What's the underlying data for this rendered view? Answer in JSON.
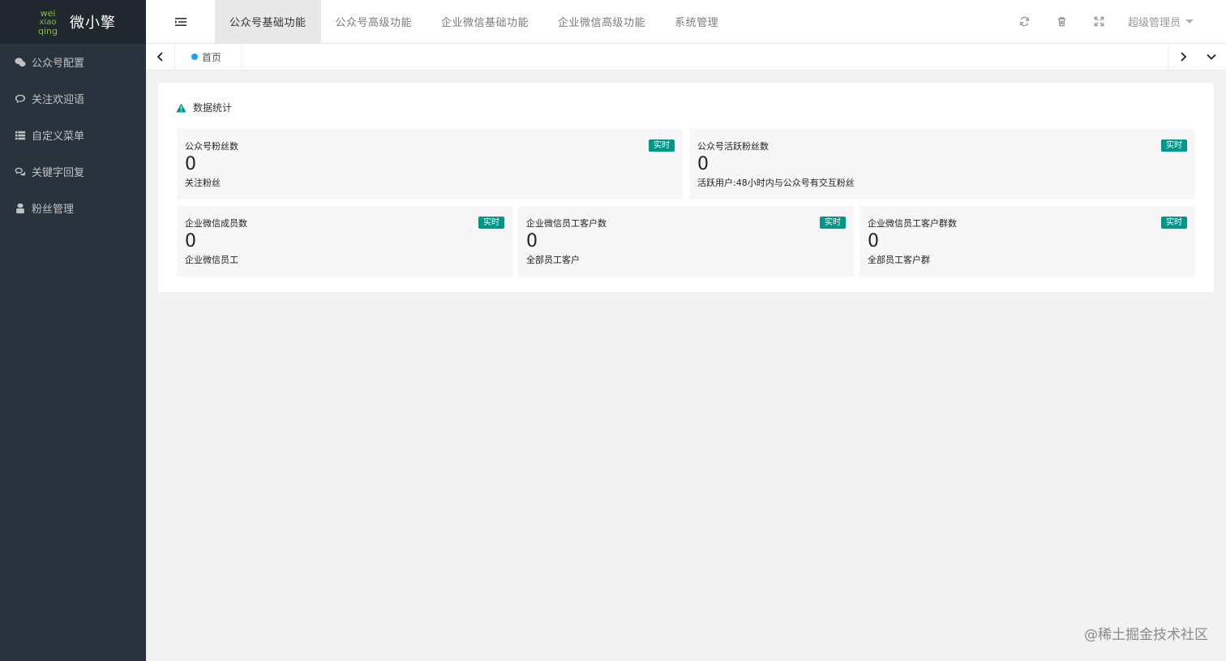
{
  "brand": {
    "logo_lines": [
      "wei",
      "xiao",
      "qing"
    ],
    "title": "微小擎",
    "logo_color": "#7fc241"
  },
  "sidebar": {
    "items": [
      {
        "label": "公众号配置",
        "icon": "wechat-icon"
      },
      {
        "label": "关注欢迎语",
        "icon": "comment-icon"
      },
      {
        "label": "自定义菜单",
        "icon": "list-icon"
      },
      {
        "label": "关键字回复",
        "icon": "chat-bubbles-icon"
      },
      {
        "label": "粉丝管理",
        "icon": "user-icon"
      }
    ]
  },
  "header": {
    "tabs": [
      {
        "label": "公众号基础功能",
        "active": true
      },
      {
        "label": "公众号高级功能",
        "active": false
      },
      {
        "label": "企业微信基础功能",
        "active": false
      },
      {
        "label": "企业微信高级功能",
        "active": false
      },
      {
        "label": "系统管理",
        "active": false
      }
    ],
    "user": "超级管理员"
  },
  "tabstrip": {
    "current_tab": "首页"
  },
  "panel": {
    "title": "数据统计",
    "cards_row1": [
      {
        "label": "公众号粉丝数",
        "value": "0",
        "sub": "关注粉丝",
        "badge": "实时"
      },
      {
        "label": "公众号活跃粉丝数",
        "value": "0",
        "sub": "活跃用户:48小时内与公众号有交互粉丝",
        "badge": "实时"
      }
    ],
    "cards_row2": [
      {
        "label": "企业微信成员数",
        "value": "0",
        "sub": "企业微信员工",
        "badge": "实时"
      },
      {
        "label": "企业微信员工客户数",
        "value": "0",
        "sub": "全部员工客户",
        "badge": "实时"
      },
      {
        "label": "企业微信员工客户群数",
        "value": "0",
        "sub": "全部员工客户群",
        "badge": "实时"
      }
    ]
  },
  "watermark": "@稀土掘金技术社区",
  "colors": {
    "sidebar_bg": "#28333e",
    "badge": "#009688",
    "tab_dot": "#1e9fff",
    "warning_icon": "#009688"
  }
}
